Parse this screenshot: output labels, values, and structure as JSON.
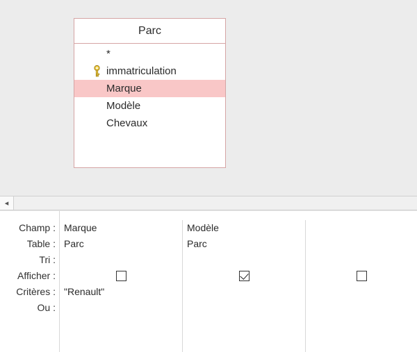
{
  "table": {
    "title": "Parc",
    "fields": [
      {
        "label": "*",
        "key": false,
        "selected": false
      },
      {
        "label": "immatriculation",
        "key": true,
        "selected": false
      },
      {
        "label": "Marque",
        "key": false,
        "selected": true
      },
      {
        "label": "Modèle",
        "key": false,
        "selected": false
      },
      {
        "label": "Chevaux",
        "key": false,
        "selected": false
      }
    ]
  },
  "gridLabels": {
    "champ": "Champ :",
    "table": "Table :",
    "tri": "Tri :",
    "afficher": "Afficher :",
    "criteres": "Critères :",
    "ou": "Ou :"
  },
  "columns": [
    {
      "champ": "Marque",
      "table": "Parc",
      "tri": "",
      "afficher": false,
      "criteres": "\"Renault\"",
      "ou": ""
    },
    {
      "champ": "Modèle",
      "table": "Parc",
      "tri": "",
      "afficher": true,
      "criteres": "",
      "ou": ""
    },
    {
      "champ": "",
      "table": "",
      "tri": "",
      "afficher": false,
      "criteres": "",
      "ou": ""
    }
  ],
  "scroll": {
    "leftGlyph": "◂"
  }
}
